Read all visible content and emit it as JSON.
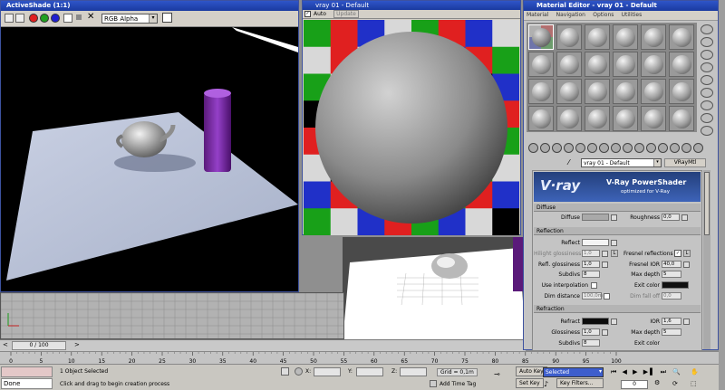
{
  "activeshade": {
    "title": "ActiveShade (1:1)",
    "channel": "RGB Alpha",
    "swatch_colors": [
      "#e02020",
      "#20a020",
      "#2020d0"
    ]
  },
  "vray_window": {
    "title": "vray 01 - Default",
    "auto_label": "Auto",
    "update_label": "Update"
  },
  "material_editor": {
    "title": "Material Editor - vray 01 - Default",
    "menu": [
      "Material",
      "Navigation",
      "Options",
      "Utilities"
    ],
    "material_name": "vray 01 - Default",
    "material_type": "VRayMtl",
    "banner_logo": "V·ray",
    "banner_title": "V-Ray PowerShader",
    "banner_subtitle": "optimized for V-Ray",
    "diffuse": {
      "section": "Diffuse",
      "diffuse_label": "Diffuse",
      "roughness_label": "Roughness",
      "roughness_value": "0,0"
    },
    "reflection": {
      "section": "Reflection",
      "reflect_label": "Reflect",
      "hilight_label": "Hilight glossiness",
      "hilight_value": "1,0",
      "hilight_lock": "L",
      "fresnel_label": "Fresnel reflections",
      "fresnel_lock": "L",
      "refl_gloss_label": "Refl. glossiness",
      "refl_gloss_value": "1,0",
      "fresnel_ior_label": "Fresnel IOR",
      "fresnel_ior_value": "40,0",
      "subdivs_label": "Subdivs",
      "subdivs_value": "8",
      "max_depth_label": "Max depth",
      "max_depth_value": "5",
      "use_interp_label": "Use interpolation",
      "exit_color_label": "Exit color",
      "dim_distance_label": "Dim distance",
      "dim_distance_value": "100,0m",
      "dim_falloff_label": "Dim fall off",
      "dim_falloff_value": "0,0"
    },
    "refraction": {
      "section": "Refraction",
      "refract_label": "Refract",
      "ior_label": "IOR",
      "ior_value": "1,6",
      "gloss_label": "Glossiness",
      "gloss_value": "1,0",
      "max_depth_label": "Max depth",
      "max_depth_value": "5",
      "subdivs_label": "Subdivs",
      "subdivs_value": "8",
      "exit_color_label": "Exit color"
    }
  },
  "timeline": {
    "frame_label": "0 / 100",
    "ticks": [
      "0",
      "5",
      "10",
      "15",
      "20",
      "25",
      "30",
      "35",
      "40",
      "45",
      "50",
      "55",
      "60",
      "65",
      "70",
      "75",
      "80",
      "85",
      "90",
      "95",
      "100"
    ]
  },
  "status": {
    "maxscript": "Done",
    "selection": "1 Object Selected",
    "prompt": "Click and drag to begin creation process",
    "x_label": "X:",
    "y_label": "Y:",
    "z_label": "Z:",
    "grid": "Grid = 0,1m",
    "add_time_tag": "Add Time Tag",
    "auto_key": "Auto Key",
    "set_key": "Set Key",
    "selected": "Selected",
    "key_filters": "Key Filters...",
    "frame_spinner": "0"
  }
}
